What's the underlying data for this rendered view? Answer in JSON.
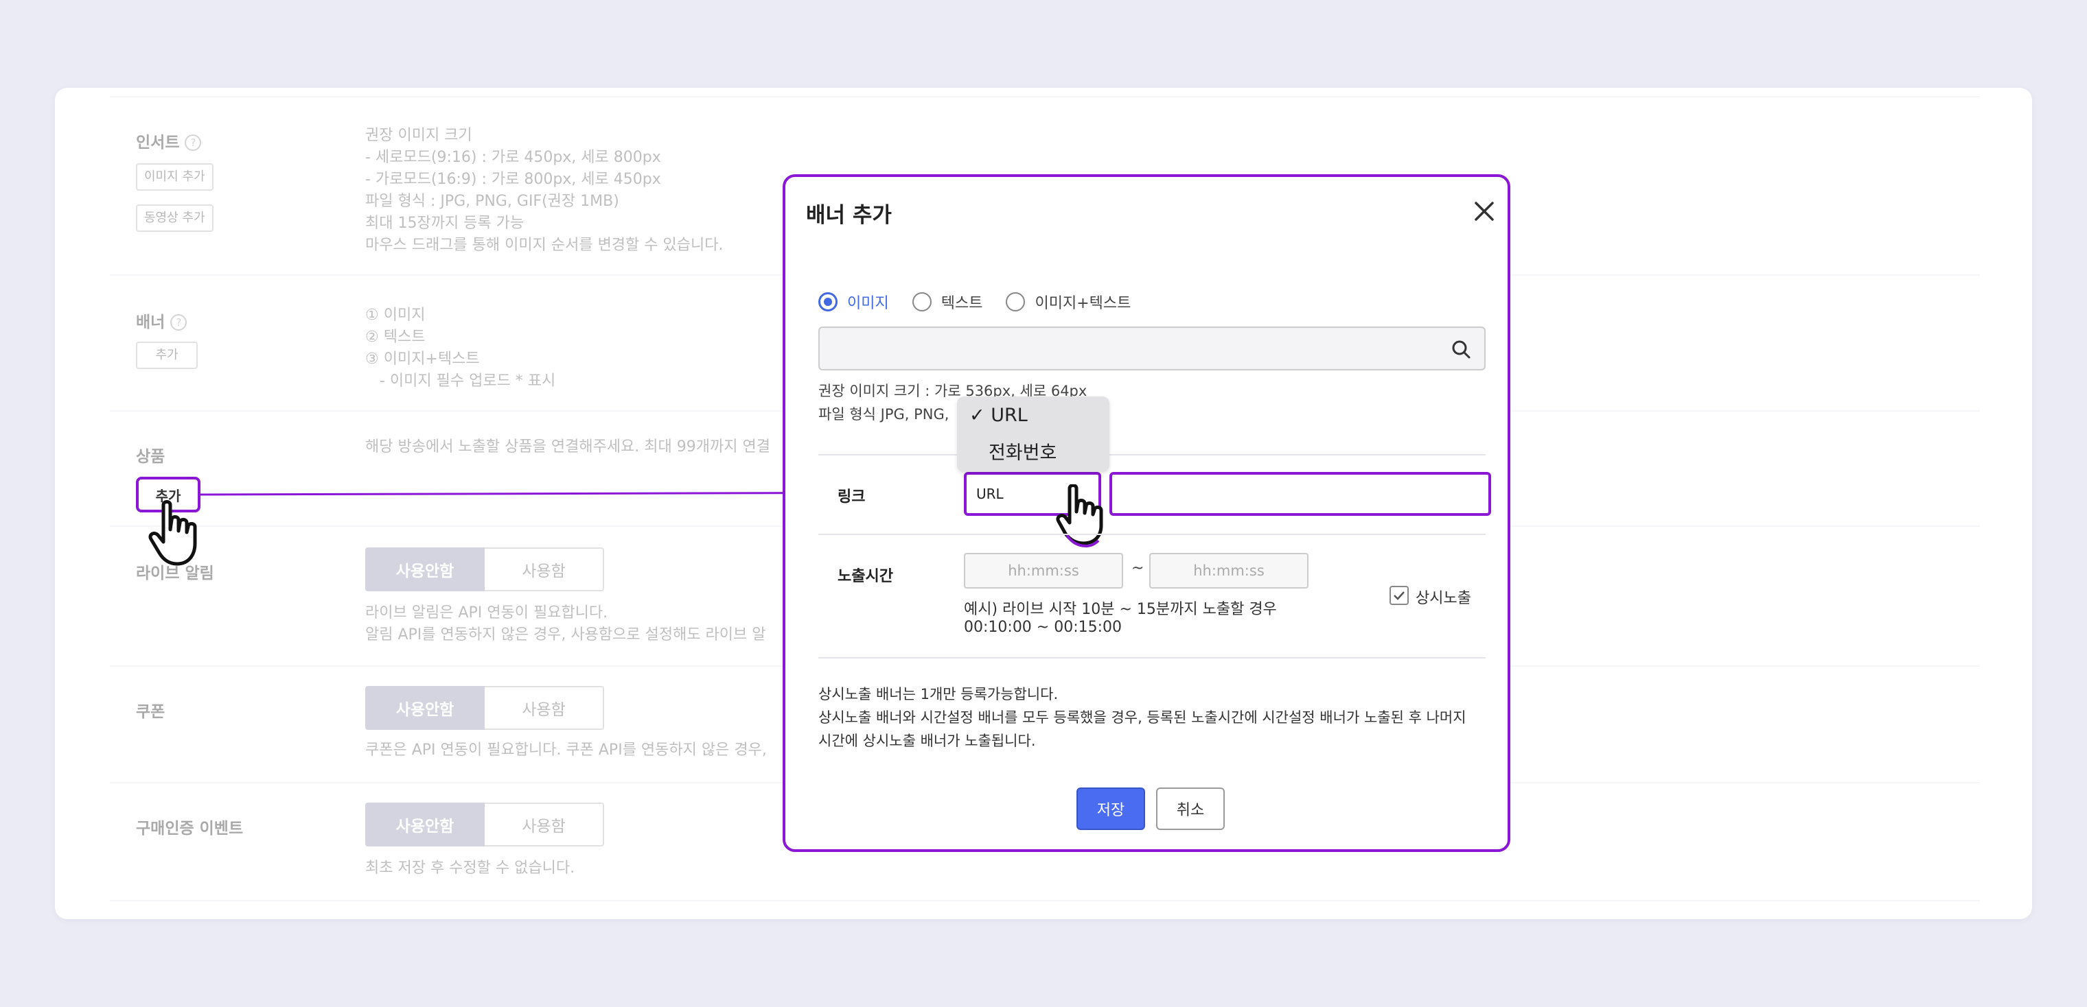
{
  "sections": {
    "insert": {
      "title": "인서트",
      "buttons": [
        "이미지 추가",
        "동영상 추가"
      ],
      "desc": [
        "권장 이미지 크기",
        "- 세로모드(9:16) : 가로 450px, 세로 800px",
        "- 가로모드(16:9) : 가로 800px, 세로 450px",
        "파일 형식 : JPG, PNG, GIF(권장 1MB)",
        "최대 15장까지 등록 가능",
        "마우스 드래그를 통해 이미지 순서를 변경할 수 있습니다."
      ]
    },
    "banner": {
      "title": "배너",
      "button": "추가",
      "desc": [
        "① 이미지",
        "② 텍스트",
        "③ 이미지+텍스트",
        "   - 이미지 필수 업로드 * 표시"
      ]
    },
    "product": {
      "title": "상품",
      "button": "추가",
      "desc": "해당 방송에서 노출할 상품을 연결해주세요. 최대 99개까지 연결"
    },
    "live_alert": {
      "title": "라이브 알림",
      "toggle_off": "사용안함",
      "toggle_on": "사용함",
      "desc": [
        "라이브 알림은 API 연동이 필요합니다.",
        "알림 API를 연동하지 않은 경우, 사용함으로 설정해도 라이브 알"
      ]
    },
    "coupon": {
      "title": "쿠폰",
      "toggle_off": "사용안함",
      "toggle_on": "사용함",
      "desc": "쿠폰은 API 연동이 필요합니다. 쿠폰 API를 연동하지 않은 경우,"
    },
    "purchase_event": {
      "title": "구매인증 이벤트",
      "toggle_off": "사용안함",
      "toggle_on": "사용함",
      "desc": "최초 저장 후 수정할 수 없습니다."
    }
  },
  "help_glyph": "?",
  "modal": {
    "title": "배너 추가",
    "close_icon": "close-icon",
    "radios": [
      {
        "label": "이미지",
        "selected": true
      },
      {
        "label": "텍스트",
        "selected": false
      },
      {
        "label": "이미지+텍스트",
        "selected": false
      }
    ],
    "search_icon": "search-icon",
    "info_size": "권장 이미지 크기 : 가로 536px, 세로 64px",
    "info_format": "파일 형식 JPG, PNG,",
    "link_label": "링크",
    "link_type": "URL",
    "dropdown_options": [
      {
        "label": "URL",
        "checked": true
      },
      {
        "label": "전화번호",
        "checked": false
      }
    ],
    "check_glyph": "✓",
    "time_label": "노출시간",
    "time_placeholder_start": "hh:mm:ss",
    "time_placeholder_end": "hh:mm:ss",
    "time_sep": "~",
    "example_line1": "예시) 라이브 시작 10분 ~ 15분까지 노출할 경우",
    "example_line2": "00:10:00 ~ 00:15:00",
    "always_show_label": "상시노출",
    "always_show_checked": true,
    "footer_notes": [
      "상시노출 배너는 1개만 등록가능합니다.",
      "상시노출 배너와 시간설정 배너를 모두 등록했을 경우, 등록된 노출시간에 시간설정 배너가 노출된 후 나머지",
      "시간에 상시노출 배너가 노출됩니다."
    ],
    "save_label": "저장",
    "cancel_label": "취소"
  },
  "colors": {
    "accent_purple": "#8a17d6",
    "primary_blue": "#4a6cf0",
    "toggle_active": "#979ab2"
  }
}
